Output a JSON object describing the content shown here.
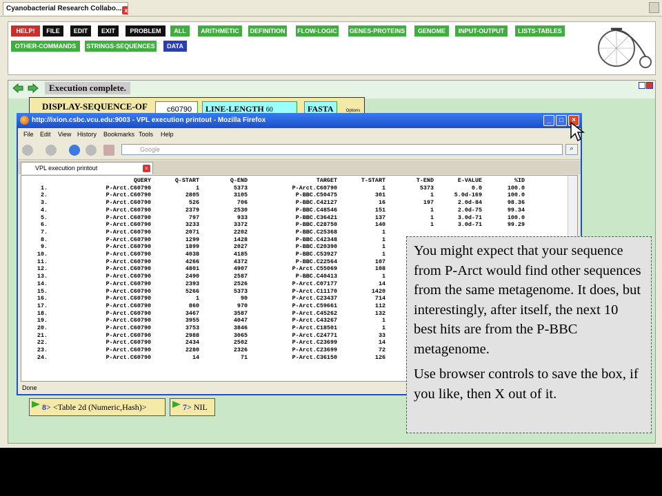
{
  "app_tab": {
    "title": "Cyanobacterial Research Collabo...",
    "close": "x"
  },
  "menu": {
    "row1": [
      "HELP!",
      "FILE",
      "EDIT",
      "EXIT",
      "PROBLEM",
      "ALL",
      "ARITHMETIC",
      "DEFINITION",
      "FLOW-LOGIC",
      "GENES-PROTEINS",
      "GENOME",
      "INPUT-OUTPUT",
      "LISTS-TABLES"
    ],
    "row2": [
      "OTHER-COMMANDS",
      "STRINGS-SEQUENCES",
      "DATA"
    ]
  },
  "workspace": {
    "status": "Execution complete.",
    "function_name": "DISPLAY-SEQUENCE-OF",
    "arg1": "c60790",
    "arg2_label": "LINE-LENGTH",
    "arg2_value": "60",
    "arg3": "FASTA",
    "options_label": "Options",
    "results": [
      {
        "num": "8>",
        "text": "<Table 2d (Numeric,Hash)>"
      },
      {
        "num": "7>",
        "text": "NIL"
      }
    ]
  },
  "firefox": {
    "title": "http://ixion.csbc.vcu.edu:9003 - VPL execution printout - Mozilla Firefox",
    "menu": [
      "File",
      "Edit",
      "View",
      "History",
      "Bookmarks",
      "Tools",
      "Help"
    ],
    "search_placeholder": "Google",
    "tab_title": "VPL execution printout",
    "status": "Done"
  },
  "table": {
    "headers": [
      "",
      "QUERY",
      "Q-START",
      "Q-END",
      "TARGET",
      "T-START",
      "T-END",
      "E-VALUE",
      "%ID"
    ],
    "rows": [
      [
        "1.",
        "P-Arct.C60790",
        "1",
        "5373",
        "P-Arct.C60790",
        "1",
        "5373",
        "0.0",
        "100.0"
      ],
      [
        "2.",
        "P-Arct.C60790",
        "2805",
        "3105",
        "P-BBC.C50475",
        "301",
        "1",
        "5.0d-169",
        "100.0"
      ],
      [
        "3.",
        "P-Arct.C60790",
        "526",
        "706",
        "P-BBC.C42127",
        "16",
        "197",
        "2.0d-84",
        "98.36"
      ],
      [
        "4.",
        "P-Arct.C60790",
        "2379",
        "2530",
        "P-BBC.C48546",
        "151",
        "1",
        "2.0d-75",
        "99.34"
      ],
      [
        "5.",
        "P-Arct.C60790",
        "797",
        "933",
        "P-BBC.C36421",
        "137",
        "1",
        "3.0d-71",
        "100.0"
      ],
      [
        "6.",
        "P-Arct.C60790",
        "3233",
        "3372",
        "P-BBC.C28750",
        "140",
        "1",
        "3.0d-71",
        "99.29"
      ],
      [
        "7.",
        "P-Arct.C60790",
        "2071",
        "2202",
        "P-BBC.C25368",
        "1",
        "",
        "",
        ""
      ],
      [
        "8.",
        "P-Arct.C60790",
        "1299",
        "1428",
        "P-BBC.C42348",
        "1",
        "",
        "",
        ""
      ],
      [
        "9.",
        "P-Arct.C60790",
        "1899",
        "2027",
        "P-BBC.C20390",
        "1",
        "",
        "",
        ""
      ],
      [
        "10.",
        "P-Arct.C60790",
        "4038",
        "4185",
        "P-BBC.C53927",
        "1",
        "",
        "",
        ""
      ],
      [
        "11.",
        "P-Arct.C60790",
        "4266",
        "4372",
        "P-BBC.C22564",
        "107",
        "",
        "",
        ""
      ],
      [
        "12.",
        "P-Arct.C60790",
        "4801",
        "4907",
        "P-Arct.C55069",
        "108",
        "",
        "",
        ""
      ],
      [
        "13.",
        "P-Arct.C60790",
        "2490",
        "2587",
        "P-BBC.C40413",
        "1",
        "",
        "",
        ""
      ],
      [
        "14.",
        "P-Arct.C60790",
        "2393",
        "2526",
        "P-Arct.C07177",
        "14",
        "",
        "",
        ""
      ],
      [
        "15.",
        "P-Arct.C60790",
        "5266",
        "5373",
        "P-Arct.C11170",
        "1420",
        "",
        "",
        ""
      ],
      [
        "16.",
        "P-Arct.C60790",
        "1",
        "90",
        "P-Arct.C23437",
        "714",
        "",
        "",
        ""
      ],
      [
        "17.",
        "P-Arct.C60790",
        "860",
        "970",
        "P-Arct.C59661",
        "112",
        "",
        "",
        ""
      ],
      [
        "18.",
        "P-Arct.C60790",
        "3467",
        "3587",
        "P-Arct.C45262",
        "132",
        "",
        "",
        ""
      ],
      [
        "19.",
        "P-Arct.C60790",
        "3955",
        "4047",
        "P-Arct.C43267",
        "1",
        "",
        "",
        ""
      ],
      [
        "20.",
        "P-Arct.C60790",
        "3753",
        "3846",
        "P-Arct.C18501",
        "1",
        "",
        "",
        ""
      ],
      [
        "21.",
        "P-Arct.C60790",
        "2988",
        "3065",
        "P-Arct.C24771",
        "33",
        "",
        "",
        ""
      ],
      [
        "22.",
        "P-Arct.C60790",
        "2434",
        "2502",
        "P-Arct.C23699",
        "14",
        "",
        "",
        ""
      ],
      [
        "23.",
        "P-Arct.C60790",
        "2280",
        "2326",
        "P-Arct.C23699",
        "72",
        "",
        "",
        ""
      ],
      [
        "24.",
        "P-Arct.C60790",
        "14",
        "71",
        "P-Arct.C36150",
        "126",
        "",
        "",
        ""
      ]
    ]
  },
  "note": {
    "p1": "You might expect that your sequence from P-Arct would find other sequences from the same metagenome. It does, but interestingly, after itself, the next 10 best hits are from the P-BBC metagenome.",
    "p2": "Use browser controls to save the box, if you like, then X out of it."
  }
}
